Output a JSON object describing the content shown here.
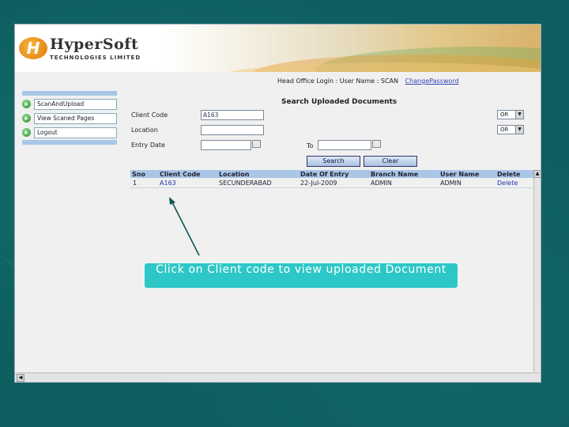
{
  "brand": {
    "logo_letter": "H",
    "name": "HyperSoft",
    "tagline": "TECHNOLOGIES LIMITED"
  },
  "header": {
    "login_info": "Head Office Login : User Name : SCAN",
    "change_password": "ChangePassword"
  },
  "sidebar": {
    "items": [
      {
        "label": "ScanAndUpload"
      },
      {
        "label": "View Scaned Pages"
      },
      {
        "label": "Logout"
      }
    ]
  },
  "form": {
    "title": "Search Uploaded Documents",
    "client_code_label": "Client Code",
    "client_code_value": "A163",
    "location_label": "Location",
    "location_value": "",
    "entry_date_label": "Entry Date",
    "entry_date_value": "",
    "to_label": "To",
    "to_value": "",
    "operator_1": "OR",
    "operator_2": "OR",
    "search_button": "Search",
    "clear_button": "Clear"
  },
  "results": {
    "columns": [
      "Sno",
      "Client Code",
      "Location",
      "Date Of Entry",
      "Branch Name",
      "User Name",
      "Delete"
    ],
    "rows": [
      {
        "sno": "1",
        "client_code": "A163",
        "location": "SECUNDERABAD",
        "date_of_entry": "22-Jul-2009",
        "branch_name": "ADMIN",
        "user_name": "ADMIN",
        "delete": "Delete"
      }
    ]
  },
  "callout": {
    "text": "Click on Client code to view uploaded Document"
  },
  "colors": {
    "background": "#0d5e5e",
    "callout": "#2ec7c7",
    "table_header": "#a9c6e6",
    "link": "#2233aa"
  }
}
